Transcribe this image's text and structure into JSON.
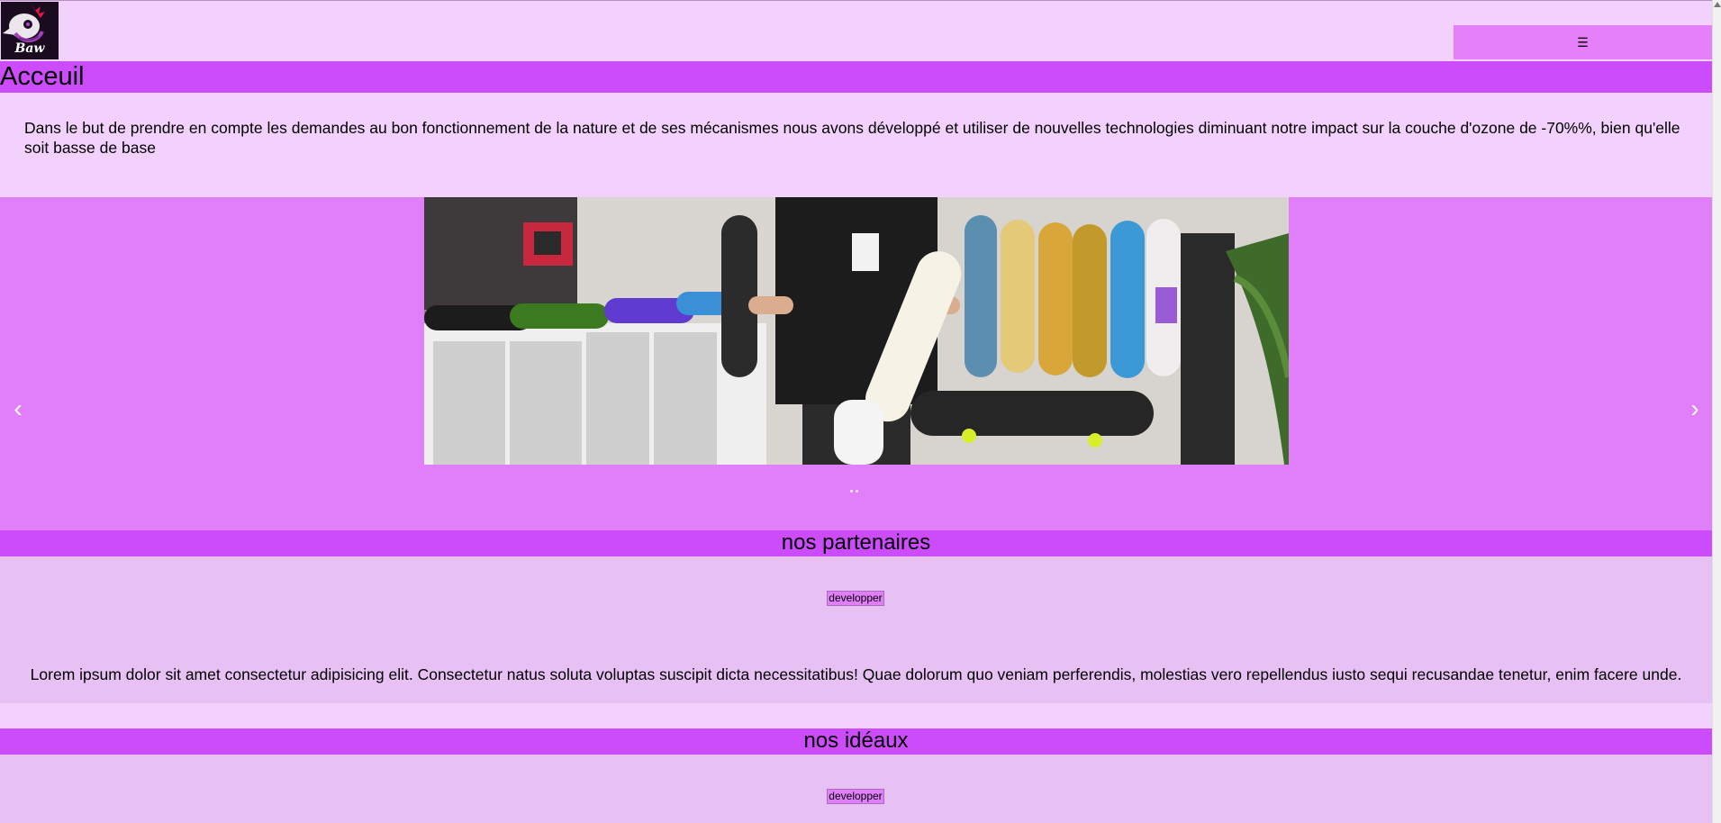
{
  "header": {
    "logo_text": "Baw",
    "menu_icon": "☰"
  },
  "accueil": {
    "title": "Acceuil",
    "text": "Dans le but de prendre en compte les demandes au bon fonctionnement de la nature et de ses mécanismes nous avons développé et utiliser de nouvelles technologies diminuant notre impact sur la couche d'ozone de -70%%, bien qu'elle soit basse de base"
  },
  "carousel": {
    "prev": "‹",
    "next": "›",
    "image_subject": "skateboard shop photo"
  },
  "partenaires": {
    "title": "nos partenaires",
    "button": "developper",
    "text": "Lorem ipsum dolor sit amet consectetur adipisicing elit. Consectetur natus soluta voluptas suscipit dicta necessitatibus! Quae dolorum quo veniam perferendis, molestias vero repellendus iusto sequi recusandae tenetur, enim facere unde."
  },
  "ideaux": {
    "title": "nos idéaux",
    "button": "developper"
  },
  "colors": {
    "band": "#cc4cfc",
    "carousel_bg": "#e17ffa",
    "page_bg": "#f2d2fc",
    "section_bg": "#e8c1f4"
  }
}
